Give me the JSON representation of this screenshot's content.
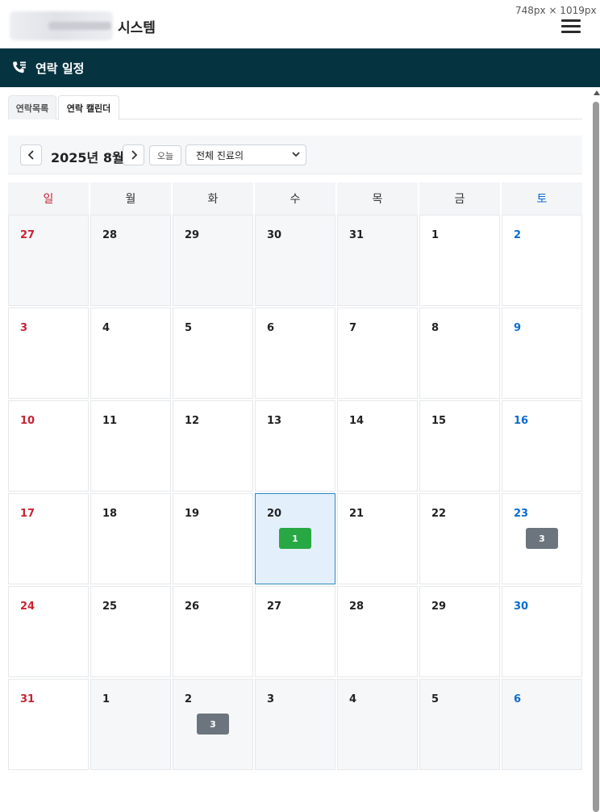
{
  "dimension_label": "748px × 1019px",
  "header": {
    "system_title": "시스템",
    "page_title": "연락 일정"
  },
  "tabs": [
    {
      "label": "연락목록",
      "active": false
    },
    {
      "label": "연락 캘린더",
      "active": true
    }
  ],
  "toolbar": {
    "prev_icon": "chevron-left-icon",
    "next_icon": "chevron-right-icon",
    "month_title": "2025년 8월",
    "today_label": "오늘",
    "doctor_filter": "전체 진료의"
  },
  "colors": {
    "header_bg": "#053340",
    "sunday": "#c82333",
    "saturday": "#0b6ccf",
    "today_bg": "#e3f0fb",
    "badge_green": "#28a745",
    "badge_gray": "#6c757d"
  },
  "weekdays": [
    "일",
    "월",
    "화",
    "수",
    "목",
    "금",
    "토"
  ],
  "weeks": [
    [
      {
        "day": "27",
        "other": true
      },
      {
        "day": "28",
        "other": true
      },
      {
        "day": "29",
        "other": true
      },
      {
        "day": "30",
        "other": true
      },
      {
        "day": "31",
        "other": true
      },
      {
        "day": "1"
      },
      {
        "day": "2"
      }
    ],
    [
      {
        "day": "3"
      },
      {
        "day": "4"
      },
      {
        "day": "5"
      },
      {
        "day": "6"
      },
      {
        "day": "7"
      },
      {
        "day": "8"
      },
      {
        "day": "9"
      }
    ],
    [
      {
        "day": "10"
      },
      {
        "day": "11"
      },
      {
        "day": "12"
      },
      {
        "day": "13"
      },
      {
        "day": "14"
      },
      {
        "day": "15"
      },
      {
        "day": "16"
      }
    ],
    [
      {
        "day": "17"
      },
      {
        "day": "18"
      },
      {
        "day": "19"
      },
      {
        "day": "20",
        "today": true,
        "badge": {
          "count": "1",
          "color": "green"
        }
      },
      {
        "day": "21"
      },
      {
        "day": "22"
      },
      {
        "day": "23",
        "badge": {
          "count": "3",
          "color": "gray"
        }
      }
    ],
    [
      {
        "day": "24"
      },
      {
        "day": "25"
      },
      {
        "day": "26"
      },
      {
        "day": "27"
      },
      {
        "day": "28"
      },
      {
        "day": "29"
      },
      {
        "day": "30"
      }
    ],
    [
      {
        "day": "31"
      },
      {
        "day": "1",
        "other": true
      },
      {
        "day": "2",
        "other": true,
        "badge": {
          "count": "3",
          "color": "gray"
        }
      },
      {
        "day": "3",
        "other": true
      },
      {
        "day": "4",
        "other": true
      },
      {
        "day": "5",
        "other": true
      },
      {
        "day": "6",
        "other": true
      }
    ]
  ]
}
